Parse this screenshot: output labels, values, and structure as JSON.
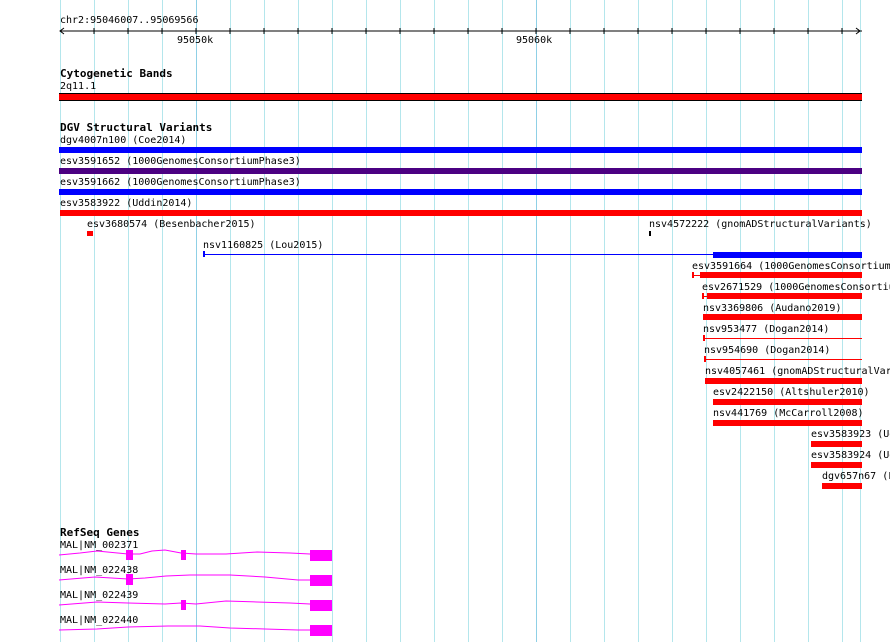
{
  "ruler": {
    "location": "chr2:95046007..95069566",
    "ticks": [
      "95050k",
      "95060k"
    ]
  },
  "cytoband_track": {
    "title": "Cytogenetic Bands",
    "band": "2q11.1"
  },
  "dgv_track": {
    "title": "DGV Structural Variants",
    "features": [
      "dgv4007n100 (Coe2014)",
      "esv3591652 (1000GenomesConsortiumPhase3)",
      "esv3591662 (1000GenomesConsortiumPhase3)",
      "esv3583922 (Uddin2014)",
      "esv3680574 (Besenbacher2015)",
      "nsv4572222 (gnomADStructuralVariants)",
      "nsv1160825 (Lou2015)",
      "esv3591664 (1000GenomesConsortium",
      "esv2671529 (1000GenomesConsortiu",
      "nsv3369806 (Audano2019)",
      "nsv953477 (Dogan2014)",
      "nsv954690 (Dogan2014)",
      "nsv4057461 (gnomADStructuralVar",
      "esv2422150 (Altshuler2010)",
      "nsv441769 (McCarroll2008)",
      "esv3583923 (Ud",
      "esv3583924 (Ud",
      "dgv657n67 (F"
    ]
  },
  "refseq_track": {
    "title": "RefSeq Genes",
    "genes": [
      "MAL|NM_002371",
      "MAL|NM_022438",
      "MAL|NM_022439",
      "MAL|NM_022440"
    ]
  },
  "colors": {
    "red": "#ff0000",
    "blue": "#0000ff",
    "purple": "#4b0082",
    "gene": "#ff00ff",
    "grid": "#b4e6ec"
  }
}
